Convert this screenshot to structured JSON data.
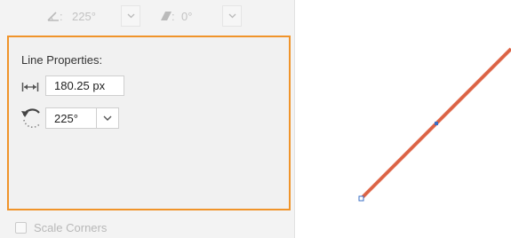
{
  "toolbar": {
    "angle_value": "225°",
    "skew_value": "0°"
  },
  "line_properties": {
    "title": "Line Properties:",
    "length_value": "180.25 px",
    "rotation_value": "225°"
  },
  "scale_corners": {
    "label": "Scale Corners",
    "checked": false
  },
  "colors": {
    "selection_border": "#f0942a",
    "line_color": "#e0684a",
    "handle_color": "#3a6fc4"
  },
  "icons": {
    "length": "length-arrows-icon",
    "rotation": "rotate-icon",
    "angle": "angle-icon",
    "skew": "skew-icon",
    "dropdown": "chevron-down-icon"
  }
}
